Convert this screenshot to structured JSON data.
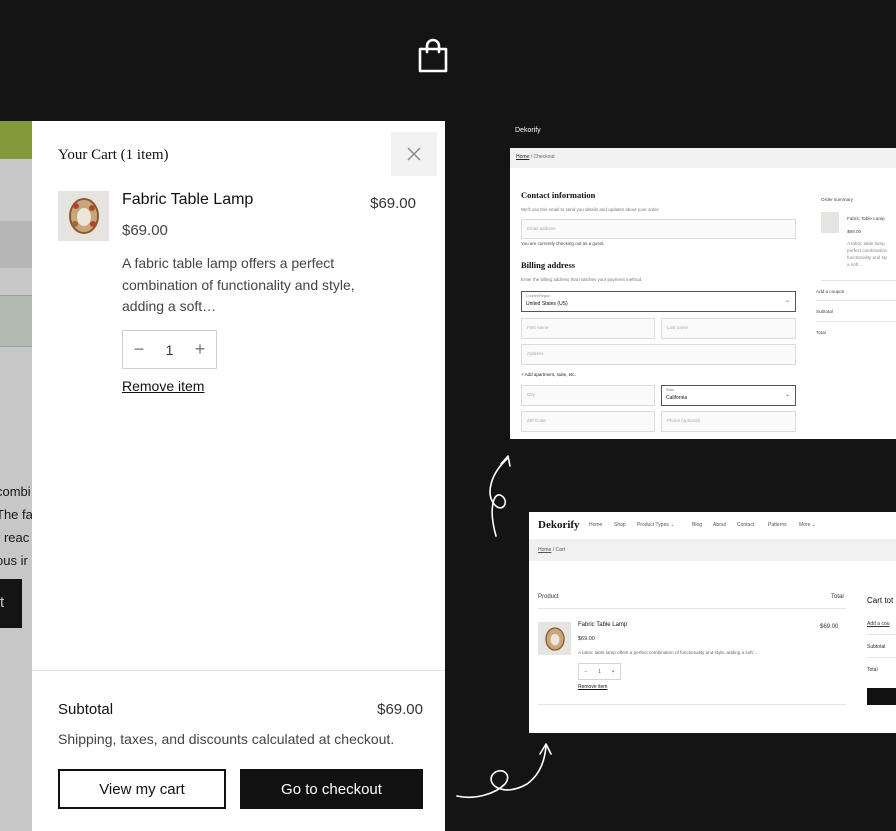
{
  "cart_drawer": {
    "title": "Your Cart (1 item)",
    "item": {
      "name": "Fabric Table Lamp",
      "price": "$69.00",
      "line_total": "$69.00",
      "description": "A fabric table lamp offers a perfect combination of functionality and style, adding a soft…",
      "quantity": "1",
      "decrement": "−",
      "increment": "+",
      "remove_label": "Remove item"
    },
    "subtotal_label": "Subtotal",
    "subtotal_value": "$69.00",
    "shipping_note": "Shipping, taxes, and discounts calculated at checkout.",
    "view_cart_label": "View my cart",
    "checkout_label": "Go to checkout",
    "close_icon": "close-icon"
  },
  "background_page": {
    "button_label": "t",
    "text_lines": [
      "combi",
      "The fa",
      "r reac",
      "ous ir"
    ]
  },
  "checkout_preview": {
    "brand": "Dekorify",
    "breadcrumb_home": "Home",
    "breadcrumb_current": " / Checkout",
    "contact_title": "Contact information",
    "contact_note": "We'll use this email to send you details and updates about your order.",
    "email_placeholder": "Email address",
    "guest_note": "You are currently checking out as a guest.",
    "billing_title": "Billing address",
    "billing_note": "Enter the billing address that matches your payment method.",
    "country_label": "Country/Region",
    "country_value": "United States (US)",
    "first_name": "First name",
    "last_name": "Last name",
    "address": "Address",
    "add_apartment": "+ Add apartment, suite, etc.",
    "city": "City",
    "state_label": "State",
    "state_value": "California",
    "zip": "ZIP Code",
    "phone": "Phone (optional)",
    "order_summary": "Order summary",
    "summary_item_name": "Fabric Table Lamp",
    "summary_item_price": "$69.00",
    "summary_desc": [
      "A fabric table lamp",
      "perfect combination",
      "functionality and sty",
      "a soft…"
    ],
    "add_coupon": "Add a coupon",
    "subtotal": "Subtotal",
    "total": "Total"
  },
  "cart_preview": {
    "brand": "Dekorify",
    "nav": [
      "Home",
      "Shop",
      "Product Types ⌄",
      "Blog",
      "About",
      "Contact",
      "Patterns",
      "More ⌄"
    ],
    "breadcrumb_home": "Home",
    "breadcrumb_current": " / Cart",
    "col_product": "Product",
    "col_total": "Total",
    "item_name": "Fabric Table Lamp",
    "item_price": "$69.00",
    "item_total": "$69.00",
    "item_desc": "A fabric table lamp offers a perfect combination of functionality and style, adding a soft…",
    "qty": "1",
    "remove": "Remove item",
    "cart_totals": "Cart tot",
    "add_coupon": "Add a cou",
    "subtotal": "Subtotal",
    "total": "Total"
  },
  "colors": {
    "background": "#141414",
    "accent_green": "#a7c64a",
    "button_dark": "#111111"
  }
}
